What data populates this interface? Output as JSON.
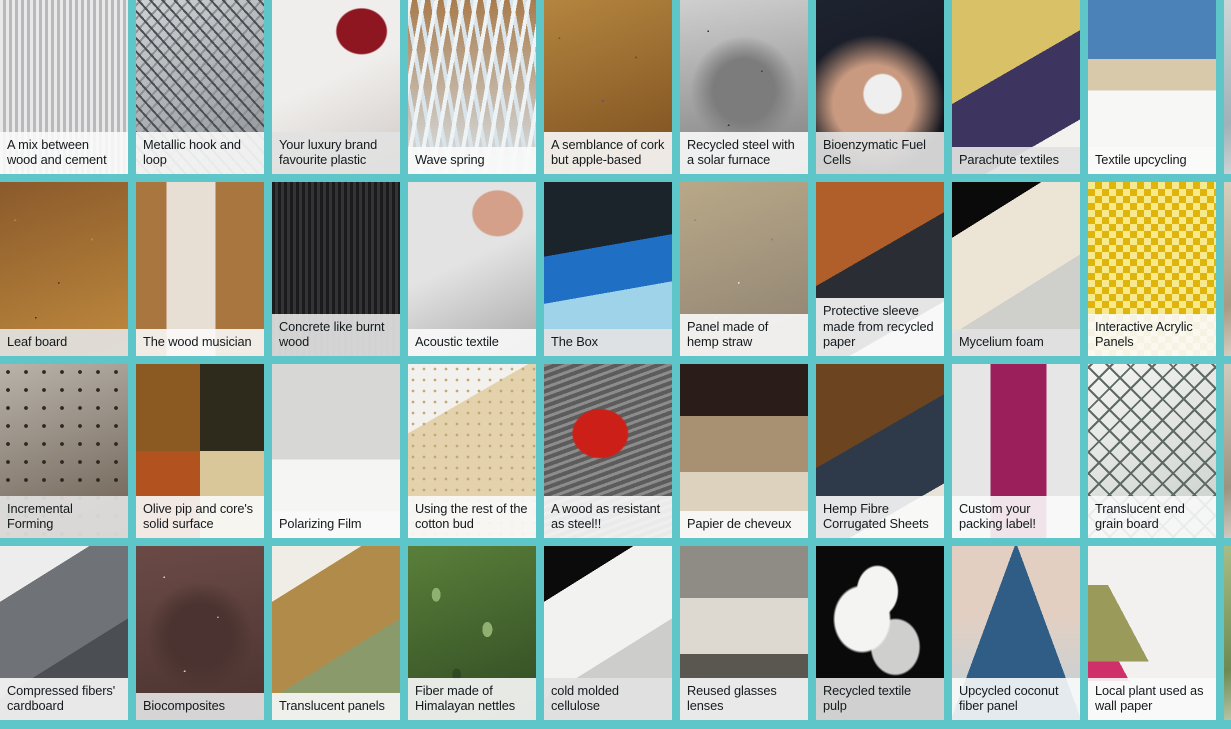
{
  "page": {
    "type": "material-thumbnail-grid",
    "background_color": "#5ec6c9",
    "columns": 9,
    "visible_rows": 4,
    "caption_background": "#f9f9f9"
  },
  "cards": [
    {
      "id": "c1",
      "caption": "A mix between wood and cement",
      "row": 1,
      "col": 1,
      "img": "interior-concrete-column",
      "c1": "#e9e9ea",
      "c2": "#b9b9bb",
      "c3": "#6d6d70",
      "style": "stripes-v",
      "dim": false
    },
    {
      "id": "c2",
      "caption": "Metallic hook and loop",
      "row": 1,
      "col": 2,
      "img": "metal-mesh-hooks",
      "c1": "#cfd2d4",
      "c2": "#8d9195",
      "c3": "#4b4f52",
      "style": "mesh",
      "dim": false
    },
    {
      "id": "c3",
      "caption": "Your luxury brand favourite plastic",
      "row": 1,
      "col": 3,
      "img": "white-plastic-packaging",
      "c1": "#f0eeec",
      "c2": "#cfc9c5",
      "c3": "#8e1621",
      "style": "plastic",
      "dim": true
    },
    {
      "id": "c4",
      "caption": "Wave spring",
      "row": 1,
      "col": 4,
      "img": "wave-spring-wire",
      "c1": "#d9e3ea",
      "c2": "#a97c4d",
      "c3": "#eef3f6",
      "style": "wave",
      "dim": false
    },
    {
      "id": "c5",
      "caption": "A semblance of cork but apple-based",
      "row": 1,
      "col": 5,
      "img": "apple-cork-discs",
      "c1": "#b4853f",
      "c2": "#7a4e1f",
      "c3": "#5d3b72",
      "style": "granules",
      "dim": false
    },
    {
      "id": "c6",
      "caption": "Recycled steel with a solar furnace",
      "row": 1,
      "col": 6,
      "img": "steel-crucible-bw",
      "c1": "#cfcfcf",
      "c2": "#7c7c7c",
      "c3": "#2c2c2c",
      "style": "speckle",
      "dim": false
    },
    {
      "id": "c7",
      "caption": "Bioenzymatic Fuel Cells",
      "row": 1,
      "col": 7,
      "img": "hand-holding-cell",
      "c1": "#1e2330",
      "c2": "#c99a80",
      "c3": "#efefef",
      "style": "darkhand",
      "dim": true
    },
    {
      "id": "c8",
      "caption": "Parachute textiles",
      "row": 1,
      "col": 8,
      "img": "yellow-purple-fabric",
      "c1": "#d9c167",
      "c2": "#3d3560",
      "c3": "#f4f2ee",
      "style": "diag2",
      "dim": true
    },
    {
      "id": "c9",
      "caption": "Textile upcycling",
      "row": 1,
      "col": 9,
      "img": "blue-thread-spools",
      "c1": "#4b82b8",
      "c2": "#d9c9ab",
      "c3": "#f7f7f5",
      "style": "spools",
      "dim": false
    },
    {
      "id": "c10",
      "caption": "Leaf board",
      "row": 2,
      "col": 1,
      "img": "leaf-particle-boards",
      "c1": "#8a5a2b",
      "c2": "#c08a3e",
      "c3": "#2f3a2a",
      "style": "granules",
      "dim": true
    },
    {
      "id": "c11",
      "caption": "The wood musician",
      "row": 2,
      "col": 2,
      "img": "toy-figure-wood",
      "c1": "#e7dfd4",
      "c2": "#a9763f",
      "c3": "#e2711d",
      "style": "figure",
      "dim": false
    },
    {
      "id": "c12",
      "caption": "Concrete like burnt wood",
      "row": 2,
      "col": 3,
      "img": "charred-black-wood",
      "c1": "#1b1b1d",
      "c2": "#343437",
      "c3": "#0c0c0d",
      "style": "stripes-v",
      "dim": true
    },
    {
      "id": "c13",
      "caption": "Acoustic textile",
      "row": 2,
      "col": 4,
      "img": "grey-sheet-in-hand",
      "c1": "#e3e3e3",
      "c2": "#a8a8a8",
      "c3": "#d4a08a",
      "style": "plastic",
      "dim": false
    },
    {
      "id": "c14",
      "caption": "The Box",
      "row": 2,
      "col": 5,
      "img": "positive-plastics-box",
      "c1": "#1b232b",
      "c2": "#1f6fc4",
      "c3": "#9fd3ea",
      "style": "boxes",
      "dim": true
    },
    {
      "id": "c15",
      "caption": "Panel made of hemp straw",
      "row": 2,
      "col": 6,
      "img": "hemp-straw-panel",
      "c1": "#b9a888",
      "c2": "#8d8272",
      "c3": "#efefed",
      "style": "granules",
      "dim": false
    },
    {
      "id": "c16",
      "caption": "Protective sleeve made from recycled paper",
      "row": 2,
      "col": 7,
      "img": "brown-paper-sleeve",
      "c1": "#b05f2a",
      "c2": "#2a2d33",
      "c3": "#e9e9ea",
      "style": "diag2",
      "dim": false
    },
    {
      "id": "c17",
      "caption": "Mycelium foam",
      "row": 2,
      "col": 8,
      "img": "mycelium-foam-slabs",
      "c1": "#0a0a0a",
      "c2": "#ece5d6",
      "c3": "#cfcfcb",
      "style": "slabs",
      "dim": true
    },
    {
      "id": "c18",
      "caption": "Interactive Acrylic Panels",
      "row": 2,
      "col": 9,
      "img": "yellow-acrylic-panel",
      "c1": "#e0b50b",
      "c2": "#f7e98c",
      "c3": "#f6f6f2",
      "style": "checker",
      "dim": false
    },
    {
      "id": "c19",
      "caption": "Incremental Forming",
      "row": 3,
      "col": 1,
      "img": "perforated-metal-dome",
      "c1": "#b9b3ab",
      "c2": "#6a5d4f",
      "c3": "#2b2722",
      "style": "dots",
      "dim": true
    },
    {
      "id": "c20",
      "caption": "Olive pip and core's solid surface",
      "row": 3,
      "col": 2,
      "img": "olive-pip-samples",
      "c1": "#f2f0ec",
      "c2": "#8a5a22",
      "c3": "#2e2a1c",
      "style": "quad",
      "dim": false
    },
    {
      "id": "c21",
      "caption": "Polarizing Film",
      "row": 3,
      "col": 3,
      "img": "polarizing-film-dog",
      "c1": "#d7d7d5",
      "c2": "#9a9a98",
      "c3": "#b22222",
      "style": "polar",
      "dim": false
    },
    {
      "id": "c22",
      "caption": "Using the rest of the cotton bud",
      "row": 3,
      "col": 4,
      "img": "cotton-bud-boards",
      "c1": "#e4d2ac",
      "c2": "#c2a878",
      "c3": "#f3f1ed",
      "style": "honeycomb",
      "dim": false
    },
    {
      "id": "c23",
      "caption": "A wood as resistant as steel!!",
      "row": 3,
      "col": 5,
      "img": "red-clamp-on-wood",
      "c1": "#8c8c8c",
      "c2": "#5c5c5c",
      "c3": "#cc1f18",
      "style": "clamp",
      "dim": false
    },
    {
      "id": "c24",
      "caption": "Papier de cheveux",
      "row": 3,
      "col": 6,
      "img": "hair-paper-swatches",
      "c1": "#2a1c18",
      "c2": "#a89172",
      "c3": "#ddd2bd",
      "style": "bands",
      "dim": false
    },
    {
      "id": "c25",
      "caption": "Hemp Fibre Corrugated Sheets",
      "row": 3,
      "col": 7,
      "img": "hemp-corrugated-sheet",
      "c1": "#6d4420",
      "c2": "#2e3a4a",
      "c3": "#e8e3d8",
      "style": "diag2",
      "dim": false
    },
    {
      "id": "c26",
      "caption": "Custom your packing label!",
      "row": 3,
      "col": 8,
      "img": "buzz-label-roll",
      "c1": "#e6e6e6",
      "c2": "#9b1f5a",
      "c3": "#e8b200",
      "style": "roll",
      "dim": false
    },
    {
      "id": "c27",
      "caption": "Translucent end grain board",
      "row": 3,
      "col": 9,
      "img": "end-grain-board-bw",
      "c1": "#c9cfcb",
      "c2": "#5e6a63",
      "c3": "#f5f5f3",
      "style": "diamond",
      "dim": false
    },
    {
      "id": "c28",
      "caption": "Compressed fibers' cardboard",
      "row": 4,
      "col": 1,
      "img": "grey-fiber-cardboard",
      "c1": "#ededed",
      "c2": "#6f7277",
      "c3": "#4b4e52",
      "style": "slabs",
      "dim": false
    },
    {
      "id": "c29",
      "caption": "Biocomposites",
      "row": 4,
      "col": 2,
      "img": "brown-biocomposite-sheet",
      "c1": "#6b4a46",
      "c2": "#4a3330",
      "c3": "#d9d2cd",
      "style": "speckle",
      "dim": true
    },
    {
      "id": "c30",
      "caption": "Translucent panels",
      "row": 4,
      "col": 3,
      "img": "stacked-translucent-panels",
      "c1": "#f0ece6",
      "c2": "#b08b4a",
      "c3": "#8a9a6a",
      "style": "slabs",
      "dim": false
    },
    {
      "id": "c31",
      "caption": "Fiber made of Himalayan nettles",
      "row": 4,
      "col": 4,
      "img": "green-nettle-plant",
      "c1": "#5a7f3a",
      "c2": "#8fb070",
      "c3": "#2f4a22",
      "style": "leaves",
      "dim": false
    },
    {
      "id": "c32",
      "caption": "cold molded cellulose",
      "row": 4,
      "col": 5,
      "img": "white-cellulose-parts",
      "c1": "#0b0b0b",
      "c2": "#f2f2f0",
      "c3": "#cdcdcb",
      "style": "slabs",
      "dim": true
    },
    {
      "id": "c33",
      "caption": "Reused glasses lenses",
      "row": 4,
      "col": 6,
      "img": "glass-lens-slab",
      "c1": "#8f8b85",
      "c2": "#ddd8d0",
      "c3": "#5a5650",
      "style": "bands",
      "dim": false
    },
    {
      "id": "c34",
      "caption": "Recycled textile pulp",
      "row": 4,
      "col": 7,
      "img": "white-fiber-pulp",
      "c1": "#0a0a0a",
      "c2": "#f4f4f2",
      "c3": "#cfcfcd",
      "style": "fluff",
      "dim": true
    },
    {
      "id": "c35",
      "caption": "Upcycled coconut fiber panel",
      "row": 4,
      "col": 8,
      "img": "blue-coconut-panel",
      "c1": "#e3cfc2",
      "c2": "#2f5d86",
      "c3": "#bfd2da",
      "style": "triangle",
      "dim": false
    },
    {
      "id": "c36",
      "caption": "Local plant used as wall paper",
      "row": 4,
      "col": 9,
      "img": "plant-wallpaper-swatches",
      "c1": "#f2f1ef",
      "c2": "#9a9a5a",
      "c3": "#d0306a",
      "style": "fan",
      "dim": false
    },
    {
      "id": "c37",
      "caption": "",
      "row": 1,
      "col": 10,
      "img": "partial-column",
      "c1": "#cfd6d8",
      "c2": "#9fb2b8",
      "c3": "#e8e8e6",
      "style": "plain",
      "dim": false
    },
    {
      "id": "c38",
      "caption": "",
      "row": 2,
      "col": 10,
      "img": "partial-column",
      "c1": "#d8cfc0",
      "c2": "#a89a84",
      "c3": "#efece6",
      "style": "plain",
      "dim": false
    },
    {
      "id": "c39",
      "caption": "",
      "row": 3,
      "col": 10,
      "img": "partial-column",
      "c1": "#d2cbbd",
      "c2": "#9c9382",
      "c3": "#efece6",
      "style": "plain",
      "dim": false
    },
    {
      "id": "c40",
      "caption": "",
      "row": 4,
      "col": 10,
      "img": "partial-column",
      "c1": "#a8bd86",
      "c2": "#6d8a52",
      "c3": "#e3e9d8",
      "style": "plain",
      "dim": false
    }
  ]
}
